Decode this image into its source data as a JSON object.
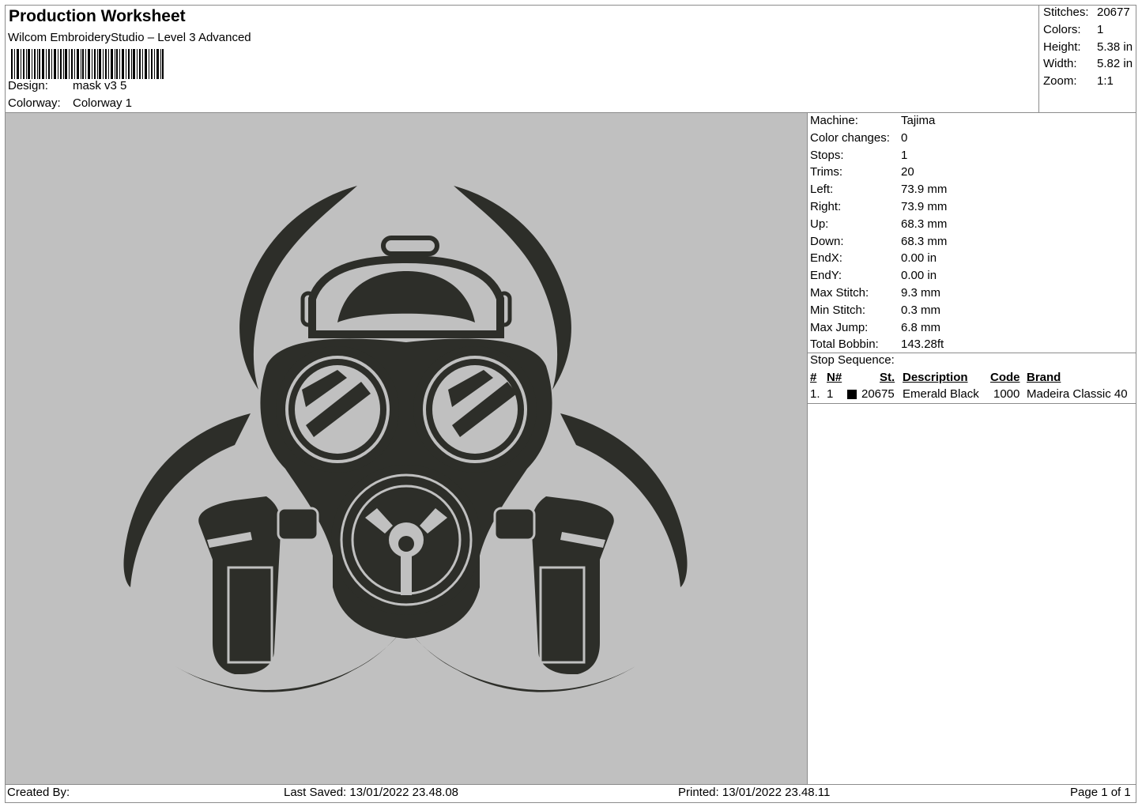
{
  "header": {
    "title": "Production Worksheet",
    "software": "Wilcom EmbroideryStudio – Level 3 Advanced",
    "design_label": "Design:",
    "design_value": "mask v3 5",
    "colorway_label": "Colorway:",
    "colorway_value": "Colorway 1"
  },
  "summary": [
    {
      "label": "Stitches:",
      "value": "20677"
    },
    {
      "label": "Colors:",
      "value": "1"
    },
    {
      "label": "Height:",
      "value": "5.38 in"
    },
    {
      "label": "Width:",
      "value": "5.82 in"
    },
    {
      "label": "Zoom:",
      "value": "1:1"
    }
  ],
  "machine_info": [
    {
      "label": "Machine:",
      "value": "Tajima"
    },
    {
      "label": "Color changes:",
      "value": "0"
    },
    {
      "label": "Stops:",
      "value": "1"
    },
    {
      "label": "Trims:",
      "value": "20"
    },
    {
      "label": "Left:",
      "value": "73.9 mm"
    },
    {
      "label": "Right:",
      "value": "73.9 mm"
    },
    {
      "label": "Up:",
      "value": "68.3 mm"
    },
    {
      "label": "Down:",
      "value": "68.3 mm"
    },
    {
      "label": "EndX:",
      "value": "0.00 in"
    },
    {
      "label": "EndY:",
      "value": "0.00 in"
    },
    {
      "label": "Max Stitch:",
      "value": "9.3 mm"
    },
    {
      "label": "Min Stitch:",
      "value": "0.3 mm"
    },
    {
      "label": "Max Jump:",
      "value": "6.8 mm"
    },
    {
      "label": "Total Bobbin:",
      "value": "143.28ft"
    }
  ],
  "stop_sequence": {
    "title": "Stop Sequence:",
    "columns": [
      "#",
      "N#",
      "St.",
      "Description",
      "Code",
      "Brand"
    ],
    "rows": [
      {
        "index": "1.",
        "needle": "1",
        "swatch_color": "#000000",
        "stitches": "20675",
        "description": "Emerald Black",
        "code": "1000",
        "brand": "Madeira Classic 40"
      }
    ]
  },
  "footer": {
    "created_by": "Created By:",
    "last_saved": "Last Saved: 13/01/2022 23.48.08",
    "printed": "Printed: 13/01/2022 23.48.11",
    "page": "Page 1 of 1"
  },
  "design_preview": {
    "background_color": "#c0c0c0",
    "thread_color": "#2d2e29",
    "icon": "gas-mask-biohazard-icon"
  }
}
